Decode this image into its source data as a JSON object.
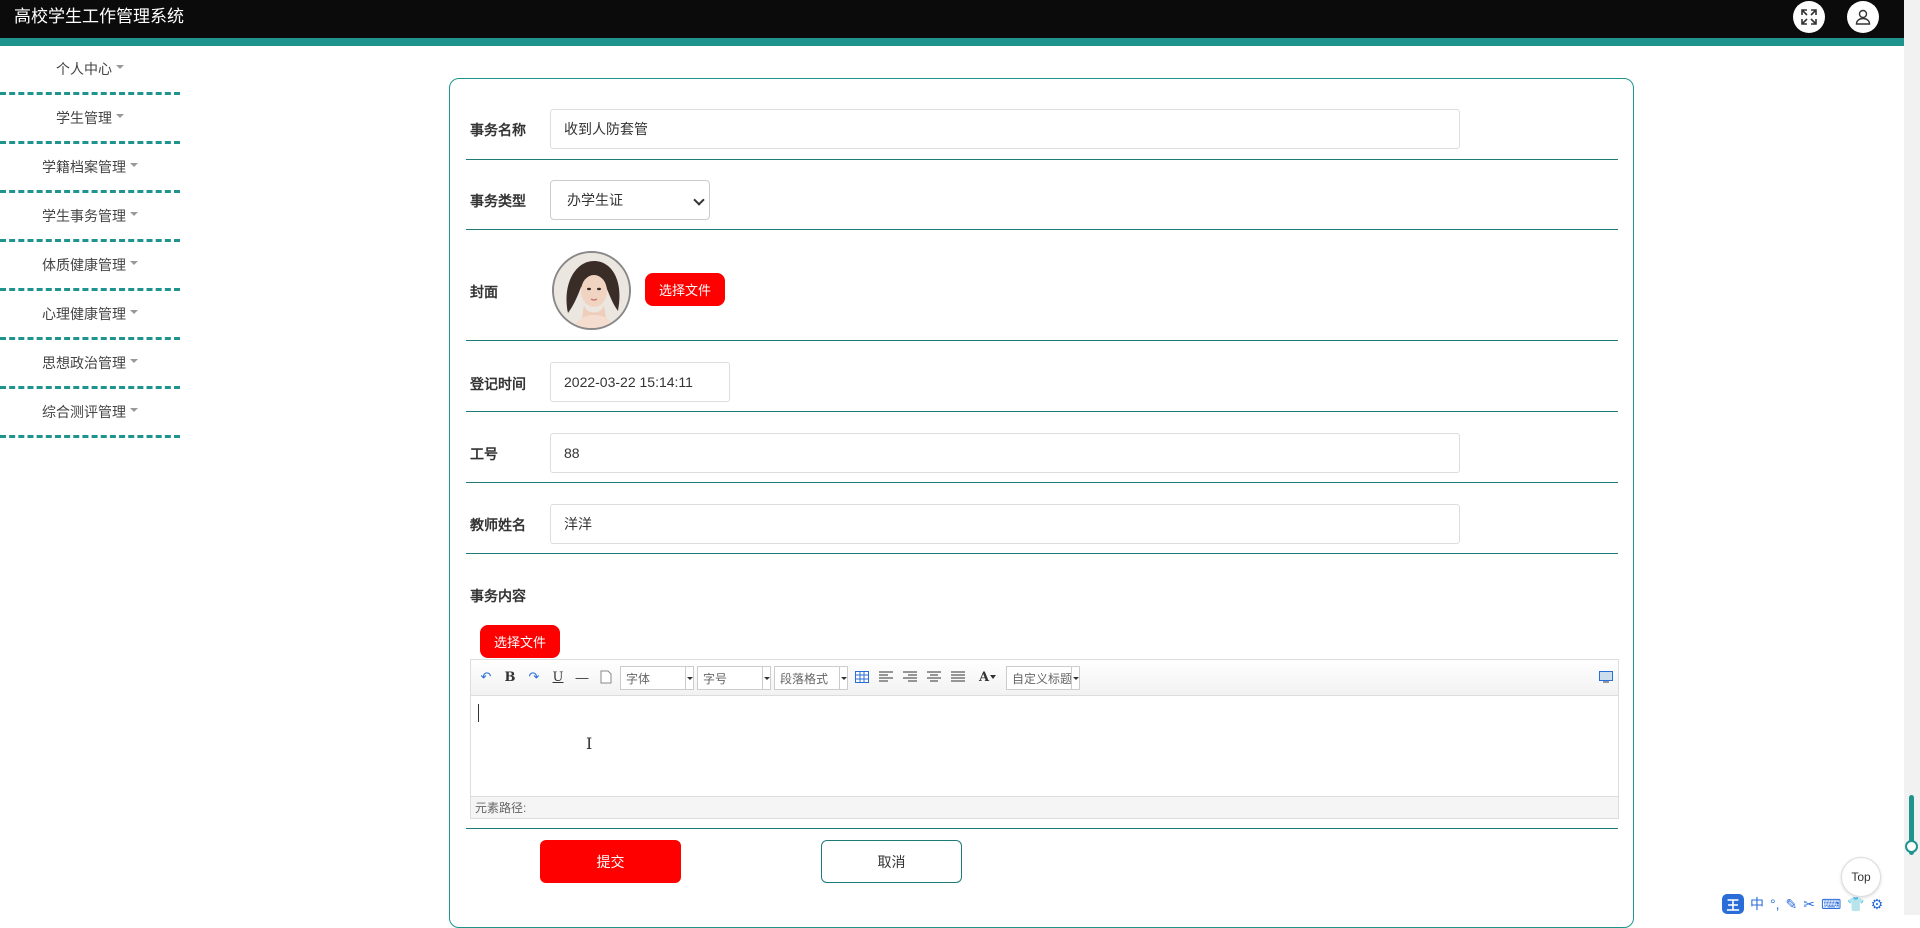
{
  "header": {
    "app_title": "高校学生工作管理系统",
    "fullscreen_icon": "fullscreen-icon",
    "user_icon": "user-icon"
  },
  "sidebar": {
    "items": [
      {
        "label": "个人中心"
      },
      {
        "label": "学生管理"
      },
      {
        "label": "学籍档案管理"
      },
      {
        "label": "学生事务管理"
      },
      {
        "label": "体质健康管理"
      },
      {
        "label": "心理健康管理"
      },
      {
        "label": "思想政治管理"
      },
      {
        "label": "综合测评管理"
      }
    ]
  },
  "form": {
    "affair_name": {
      "label": "事务名称",
      "value": "收到人防套管"
    },
    "affair_type": {
      "label": "事务类型",
      "value": "办学生证"
    },
    "cover": {
      "label": "封面",
      "choose_file": "选择文件"
    },
    "register_time": {
      "label": "登记时间",
      "value": "2022-03-22 15:14:11"
    },
    "staff_id": {
      "label": "工号",
      "value": "88"
    },
    "teacher_name": {
      "label": "教师姓名",
      "value": "洋洋"
    },
    "affair_content": {
      "label": "事务内容",
      "choose_file": "选择文件"
    },
    "editor": {
      "font_family": "字体",
      "font_size": "字号",
      "paragraph": "段落格式",
      "custom_title": "自定义标题",
      "path_label": "元素路径:"
    },
    "submit": "提交",
    "cancel": "取消"
  },
  "misc": {
    "top_button": "Top",
    "ime": [
      "中",
      "°,",
      "✎",
      "✂",
      "⌨",
      "👕",
      "⚙"
    ]
  },
  "colors": {
    "accent": "#1f948e",
    "danger": "#fe0000",
    "header_bg": "#0b0b0b"
  }
}
